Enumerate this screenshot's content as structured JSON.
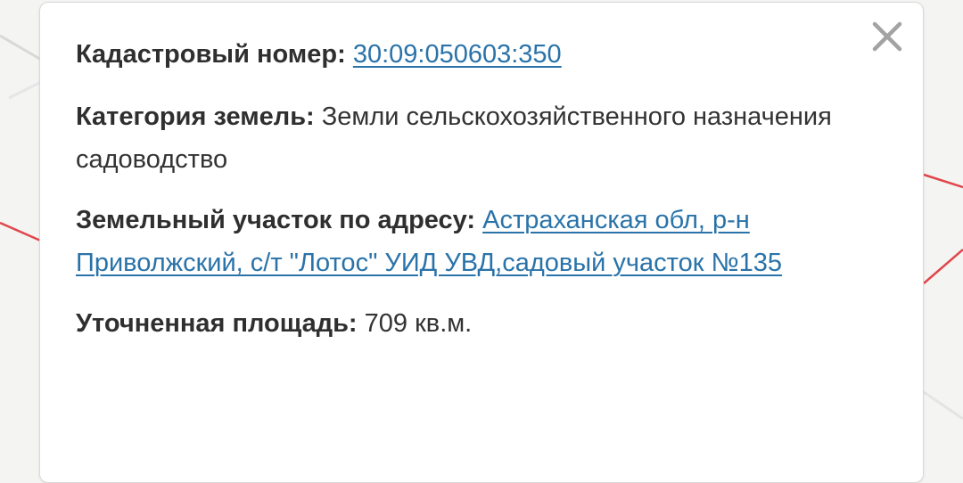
{
  "close_icon": "close-icon",
  "fields": {
    "cadastral": {
      "label": "Кадастровый номер:",
      "value": "30:09:050603:350"
    },
    "category": {
      "label": "Категория земель:",
      "value": "Земли сельскохозяйственного назначения",
      "usage": "садоводство"
    },
    "address": {
      "label": "Земельный участок по адресу:",
      "value": "Астраханская обл, р-н Приволжский, с/т \"Лотос\" УИД УВД,садовый участок №135"
    },
    "area": {
      "label": "Уточненная площадь:",
      "value": "709 кв.м."
    }
  },
  "colors": {
    "link": "#2a73a9",
    "map_boundary": "#e0474c"
  }
}
